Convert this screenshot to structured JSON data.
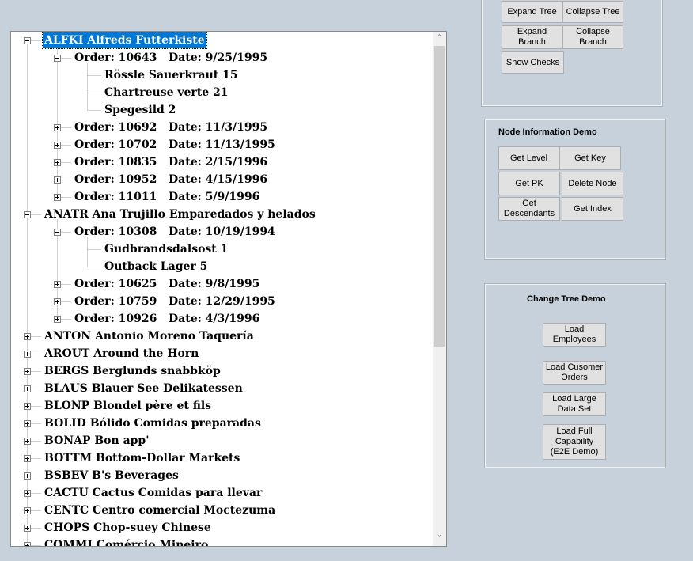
{
  "tree": {
    "nodes": [
      {
        "level": 0,
        "text": "ALFKI Alfreds Futterkiste",
        "expander": "minus",
        "selected": true
      },
      {
        "level": 1,
        "text": "Order: 10643   Date: 9/25/1995",
        "expander": "minus"
      },
      {
        "level": 2,
        "text": "Rössle Sauerkraut 15",
        "expander": "none"
      },
      {
        "level": 2,
        "text": "Chartreuse verte 21",
        "expander": "none"
      },
      {
        "level": 2,
        "text": "Spegesild 2",
        "expander": "none"
      },
      {
        "level": 1,
        "text": "Order: 10692   Date: 11/3/1995",
        "expander": "plus"
      },
      {
        "level": 1,
        "text": "Order: 10702   Date: 11/13/1995",
        "expander": "plus"
      },
      {
        "level": 1,
        "text": "Order: 10835   Date: 2/15/1996",
        "expander": "plus"
      },
      {
        "level": 1,
        "text": "Order: 10952   Date: 4/15/1996",
        "expander": "plus"
      },
      {
        "level": 1,
        "text": "Order: 11011   Date: 5/9/1996",
        "expander": "plus"
      },
      {
        "level": 0,
        "text": "ANATR Ana Trujillo Emparedados y helados",
        "expander": "minus"
      },
      {
        "level": 1,
        "text": "Order: 10308   Date: 10/19/1994",
        "expander": "minus"
      },
      {
        "level": 2,
        "text": "Gudbrandsdalsost 1",
        "expander": "none"
      },
      {
        "level": 2,
        "text": "Outback Lager 5",
        "expander": "none"
      },
      {
        "level": 1,
        "text": "Order: 10625   Date: 9/8/1995",
        "expander": "plus"
      },
      {
        "level": 1,
        "text": "Order: 10759   Date: 12/29/1995",
        "expander": "plus"
      },
      {
        "level": 1,
        "text": "Order: 10926   Date: 4/3/1996",
        "expander": "plus"
      },
      {
        "level": 0,
        "text": "ANTON Antonio Moreno Taquería",
        "expander": "plus"
      },
      {
        "level": 0,
        "text": "AROUT Around the Horn",
        "expander": "plus"
      },
      {
        "level": 0,
        "text": "BERGS Berglunds snabbköp",
        "expander": "plus"
      },
      {
        "level": 0,
        "text": "BLAUS Blauer See Delikatessen",
        "expander": "plus"
      },
      {
        "level": 0,
        "text": "BLONP Blondel père et fils",
        "expander": "plus"
      },
      {
        "level": 0,
        "text": "BOLID Bólido Comidas preparadas",
        "expander": "plus"
      },
      {
        "level": 0,
        "text": "BONAP Bon app'",
        "expander": "plus"
      },
      {
        "level": 0,
        "text": "BOTTM Bottom-Dollar Markets",
        "expander": "plus"
      },
      {
        "level": 0,
        "text": "BSBEV B's Beverages",
        "expander": "plus"
      },
      {
        "level": 0,
        "text": "CACTU Cactus Comidas para llevar",
        "expander": "plus"
      },
      {
        "level": 0,
        "text": "CENTC Centro comercial Moctezuma",
        "expander": "plus"
      },
      {
        "level": 0,
        "text": "CHOPS Chop-suey Chinese",
        "expander": "plus"
      },
      {
        "level": 0,
        "text": "COMMI Comércio Mineiro",
        "expander": "plus"
      }
    ],
    "scroll_up_glyph": "˄",
    "scroll_down_glyph": "˅"
  },
  "tree_ops": {
    "expand_tree": "Expand Tree",
    "collapse_tree": "Collapse Tree",
    "expand_branch": "Expand Branch",
    "collapse_branch": "Collapse\nBranch",
    "show_checks": "Show Checks"
  },
  "node_info": {
    "title": "Node Information Demo",
    "get_level": "Get Level",
    "get_key": "Get Key",
    "get_pk": "Get PK",
    "delete_node": "Delete Node",
    "get_descendants": "Get\nDescendants",
    "get_index": "Get Index"
  },
  "change_tree": {
    "title": "Change Tree Demo",
    "load_employees": "Load\nEmployees",
    "load_customer_orders": "Load Cusomer\nOrders",
    "load_large_data_set": "Load Large\nData Set",
    "load_full_capability": "Load Full\nCapability\n(E2E Demo)"
  },
  "colors": {
    "background": "#c6d1dc",
    "selection": "#0078d7",
    "button_face": "#e1e1e1"
  }
}
